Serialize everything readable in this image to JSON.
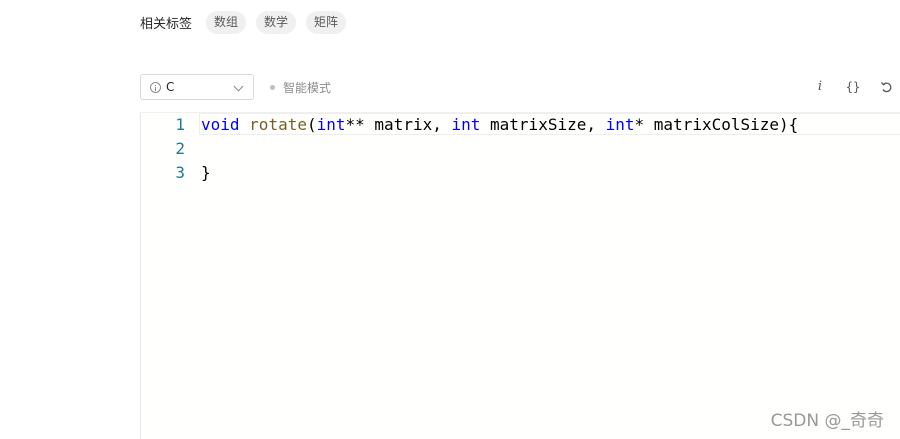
{
  "tags": {
    "label": "相关标签",
    "items": [
      "数组",
      "数学",
      "矩阵"
    ]
  },
  "toolbar": {
    "language": "C",
    "smart_mode": "智能模式",
    "italic_label": "i",
    "format_label": "{}",
    "undo_icon": "undo-icon"
  },
  "editor": {
    "lines": [
      {
        "number": "1",
        "tokens": [
          {
            "text": "void",
            "type": "keyword"
          },
          {
            "text": " ",
            "type": "plain"
          },
          {
            "text": "rotate",
            "type": "function"
          },
          {
            "text": "(",
            "type": "plain"
          },
          {
            "text": "int",
            "type": "keyword"
          },
          {
            "text": "** matrix, ",
            "type": "plain"
          },
          {
            "text": "int",
            "type": "keyword"
          },
          {
            "text": " matrixSize, ",
            "type": "plain"
          },
          {
            "text": "int",
            "type": "keyword"
          },
          {
            "text": "* matrixColSize){",
            "type": "plain"
          }
        ]
      },
      {
        "number": "2",
        "tokens": []
      },
      {
        "number": "3",
        "tokens": [
          {
            "text": "}",
            "type": "plain"
          }
        ]
      }
    ]
  },
  "watermark": "CSDN @_奇奇",
  "colors": {
    "keyword": "#0000ff",
    "function": "#795e26",
    "line_number": "#237893"
  }
}
